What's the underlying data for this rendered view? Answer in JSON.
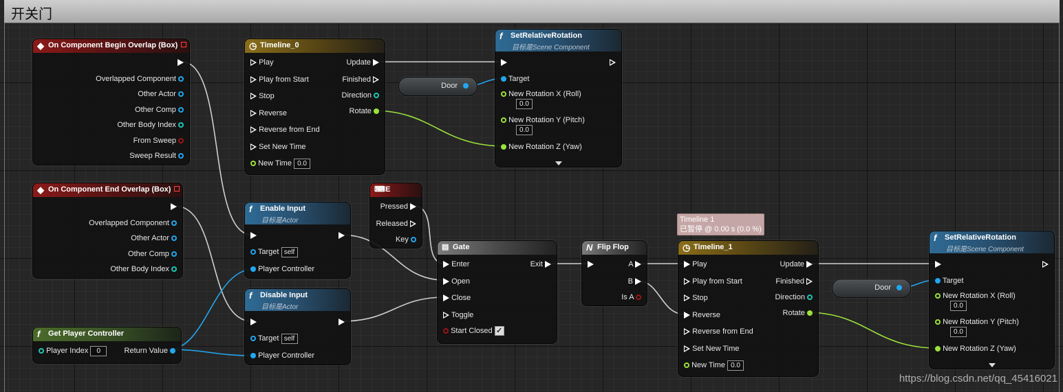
{
  "graph_title": "开关门",
  "watermark": "https://blog.csdn.net/qq_45416021",
  "colors": {
    "exec_wire": "#cfcfcf",
    "object_wire": "#22a7ef",
    "float_wire": "#9be23b",
    "event_header": "#8b1a1a",
    "timeline_header": "#8a6e1a",
    "function_header": "#2f6b95"
  },
  "nodes": {
    "begin_overlap": {
      "title": "On Component Begin Overlap (Box)",
      "pins": [
        "Overlapped Component",
        "Other Actor",
        "Other Comp",
        "Other Body Index",
        "From Sweep",
        "Sweep Result"
      ]
    },
    "end_overlap": {
      "title": "On Component End Overlap (Box)",
      "pins": [
        "Overlapped Component",
        "Other Actor",
        "Other Comp",
        "Other Body Index"
      ]
    },
    "get_player_controller": {
      "title": "Get Player Controller",
      "player_index_label": "Player Index",
      "player_index_value": "0",
      "return_label": "Return Value"
    },
    "timeline0": {
      "title": "Timeline_0",
      "inputs": [
        "Play",
        "Play from Start",
        "Stop",
        "Reverse",
        "Reverse from End",
        "Set New Time",
        "New Time"
      ],
      "new_time_value": "0.0",
      "outputs": [
        "Update",
        "Finished",
        "Direction",
        "Rotate"
      ]
    },
    "door_var_1": {
      "label": "Door"
    },
    "set_rot_1": {
      "title": "SetRelativeRotation",
      "subtitle": "目标是Scene Component",
      "target": "Target",
      "roll": "New Rotation X (Roll)",
      "roll_value": "0.0",
      "pitch": "New Rotation Y (Pitch)",
      "pitch_value": "0.0",
      "yaw": "New Rotation Z (Yaw)"
    },
    "enable_input": {
      "title": "Enable Input",
      "subtitle": "目标是Actor",
      "target": "Target",
      "target_value": "self",
      "pc": "Player Controller"
    },
    "disable_input": {
      "title": "Disable Input",
      "subtitle": "目标是Actor",
      "target": "Target",
      "target_value": "self",
      "pc": "Player Controller"
    },
    "key_e": {
      "title": "E",
      "pressed": "Pressed",
      "released": "Released",
      "key": "Key"
    },
    "gate": {
      "title": "Gate",
      "enter": "Enter",
      "exit": "Exit",
      "open": "Open",
      "close": "Close",
      "toggle": "Toggle",
      "start_closed": "Start Closed",
      "start_closed_check": "✓"
    },
    "flip_flop": {
      "title": "Flip Flop",
      "a": "A",
      "b": "B",
      "is_a": "Is A"
    },
    "timeline1_tooltip": {
      "line1": "Timeline 1",
      "line2": "已暂停 @ 0.00 s (0.0 %)"
    },
    "timeline1": {
      "title": "Timeline_1",
      "inputs": [
        "Play",
        "Play from Start",
        "Stop",
        "Reverse",
        "Reverse from End",
        "Set New Time",
        "New Time"
      ],
      "new_time_value": "0.0",
      "outputs": [
        "Update",
        "Finished",
        "Direction",
        "Rotate"
      ]
    },
    "door_var_2": {
      "label": "Door"
    },
    "set_rot_2": {
      "title": "SetRelativeRotation",
      "subtitle": "目标是Scene Component",
      "target": "Target",
      "roll": "New Rotation X (Roll)",
      "roll_value": "0.0",
      "pitch": "New Rotation Y (Pitch)",
      "pitch_value": "0.0",
      "yaw": "New Rotation Z (Yaw)"
    }
  }
}
